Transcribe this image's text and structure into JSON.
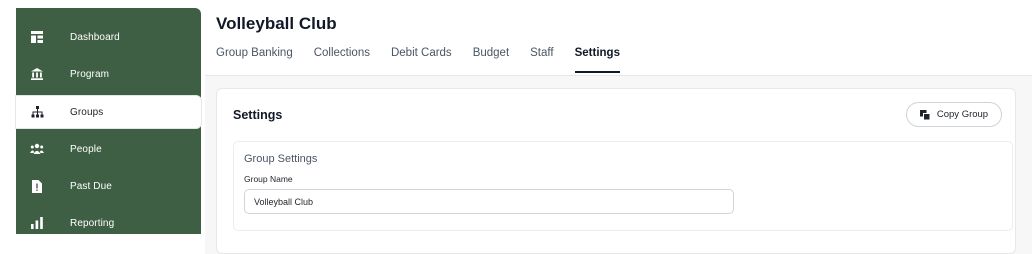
{
  "sidebar": {
    "items": [
      {
        "label": "Dashboard",
        "icon": "dashboard-icon"
      },
      {
        "label": "Program",
        "icon": "bank-icon"
      },
      {
        "label": "Groups",
        "icon": "org-chart-icon",
        "active": true
      },
      {
        "label": "People",
        "icon": "people-icon"
      },
      {
        "label": "Past Due",
        "icon": "document-alert-icon"
      },
      {
        "label": "Reporting",
        "icon": "bar-chart-icon"
      }
    ]
  },
  "header": {
    "title": "Volleyball Club"
  },
  "tabs": [
    {
      "label": "Group Banking"
    },
    {
      "label": "Collections"
    },
    {
      "label": "Debit Cards"
    },
    {
      "label": "Budget"
    },
    {
      "label": "Staff"
    },
    {
      "label": "Settings",
      "active": true
    }
  ],
  "settings": {
    "title": "Settings",
    "copy_button": "Copy Group",
    "section_title": "Group Settings",
    "group_name_label": "Group Name",
    "group_name_value": "Volleyball Club"
  },
  "colors": {
    "sidebar_bg": "#3f5f45",
    "text_primary": "#111827"
  }
}
